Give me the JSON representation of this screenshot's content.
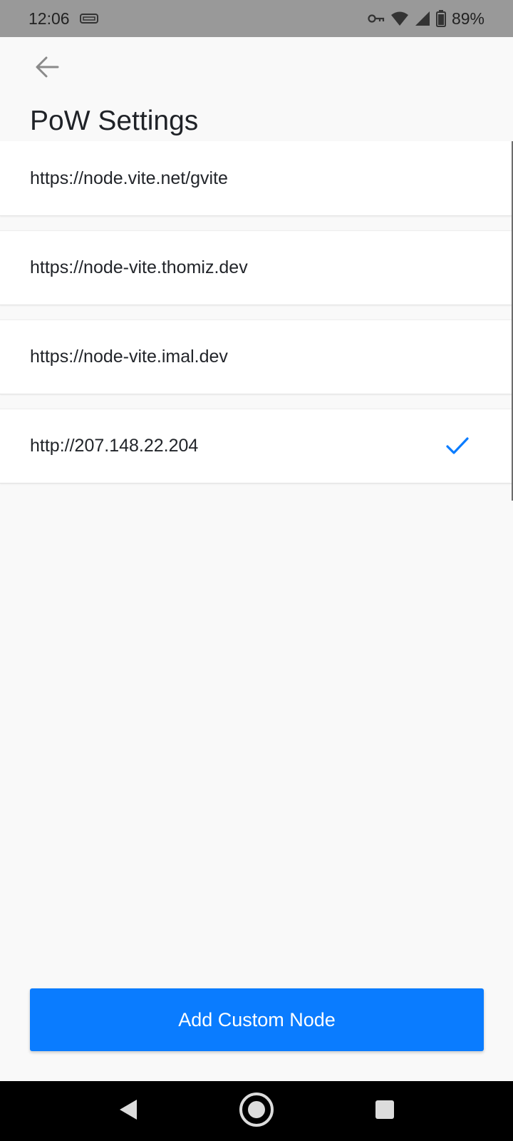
{
  "status_bar": {
    "time": "12:06",
    "battery": "89%",
    "icons": [
      "sim-card-icon",
      "vpn-key-icon",
      "wifi-icon",
      "signal-icon",
      "battery-icon"
    ]
  },
  "header": {
    "back_icon": "arrow-left-icon",
    "title": "PoW Settings"
  },
  "nodes": [
    {
      "url": "https://node.vite.net/gvite",
      "selected": false
    },
    {
      "url": "https://node-vite.thomiz.dev",
      "selected": false
    },
    {
      "url": "https://node-vite.imal.dev",
      "selected": false
    },
    {
      "url": "http://207.148.22.204",
      "selected": true
    }
  ],
  "actions": {
    "add_node_label": "Add Custom Node"
  },
  "colors": {
    "accent": "#0a7cff",
    "status_bar": "#999999",
    "background": "#f9f9f9"
  },
  "nav_bar": {
    "icons": [
      "back-triangle-icon",
      "home-circle-icon",
      "recents-square-icon"
    ]
  }
}
